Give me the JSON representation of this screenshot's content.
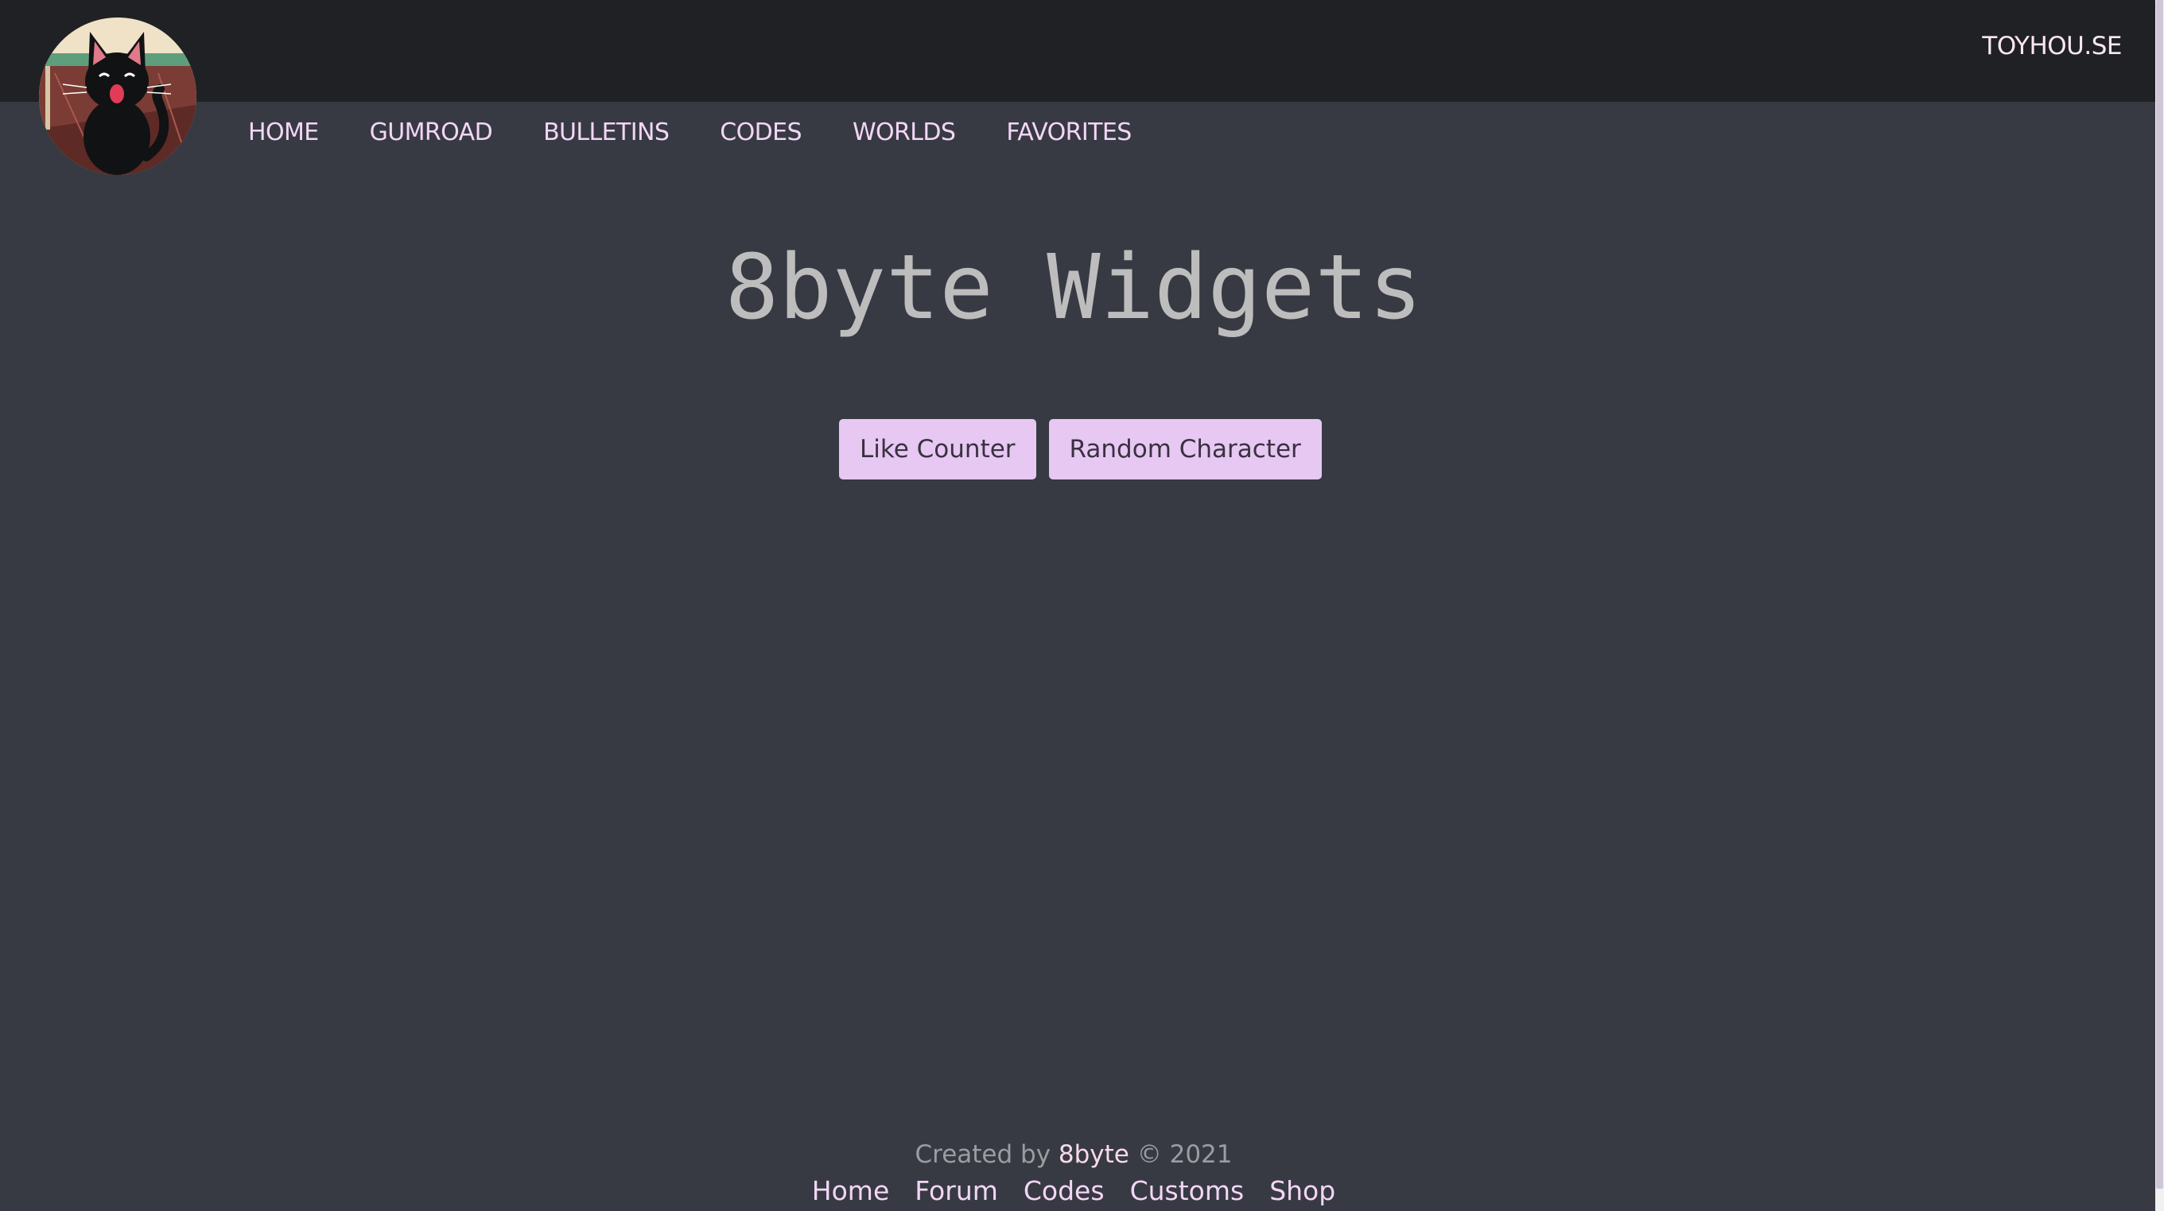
{
  "header": {
    "site_link": "TOYHOU.SE",
    "avatar_icon": "black-cat-avatar-icon"
  },
  "nav": {
    "items": [
      {
        "label": "HOME"
      },
      {
        "label": "GUMROAD"
      },
      {
        "label": "BULLETINS"
      },
      {
        "label": "CODES"
      },
      {
        "label": "WORLDS"
      },
      {
        "label": "FAVORITES"
      }
    ]
  },
  "main": {
    "title": "8byte Widgets",
    "buttons": [
      {
        "label": "Like Counter"
      },
      {
        "label": "Random Character"
      }
    ]
  },
  "footer": {
    "created_by_prefix": "Created by",
    "author": "8byte",
    "copyright_suffix": "© 2021",
    "links": [
      {
        "label": "Home"
      },
      {
        "label": "Forum"
      },
      {
        "label": "Codes"
      },
      {
        "label": "Customs"
      },
      {
        "label": "Shop"
      }
    ]
  },
  "colors": {
    "page_background": "#373a43",
    "topbar_background": "#202125",
    "accent_pink": "#e6c8f3",
    "nav_text": "#f3d6f6",
    "title_text": "#bdbdbd"
  }
}
